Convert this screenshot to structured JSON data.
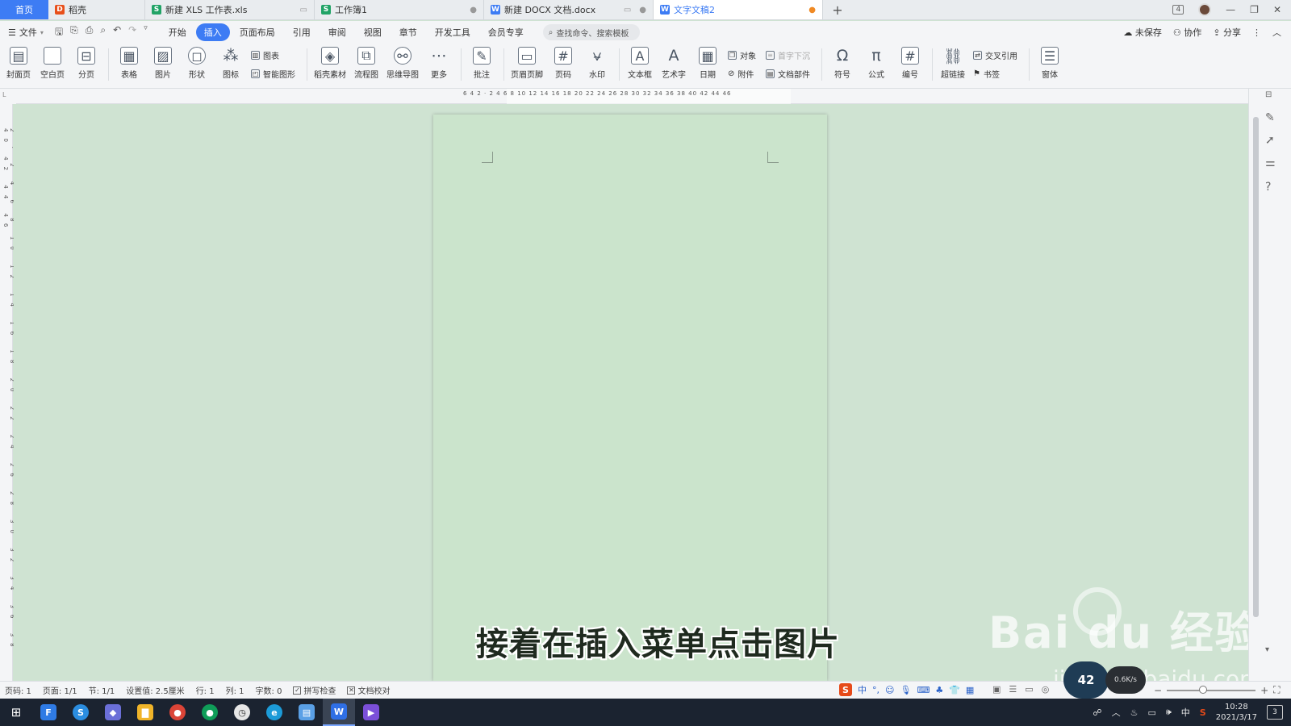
{
  "tabs": {
    "home": "首页",
    "items": [
      {
        "label": "稻壳",
        "icon": "docer-icon",
        "color": "#e8501b",
        "glyph": "D"
      },
      {
        "label": "新建 XLS 工作表.xls",
        "icon": "xls-icon",
        "color": "#21a366",
        "glyph": "S"
      },
      {
        "label": "工作簿1",
        "icon": "sheet-icon",
        "color": "#21a366",
        "glyph": "S"
      },
      {
        "label": "新建 DOCX 文档.docx",
        "icon": "docx-icon",
        "color": "#3d7cf4",
        "glyph": "W"
      },
      {
        "label": "文字文稿2",
        "icon": "docx-icon",
        "color": "#3d7cf4",
        "glyph": "W"
      }
    ],
    "add": "+",
    "window_badge": "4"
  },
  "menubar": {
    "file": "文件",
    "items": [
      "开始",
      "插入",
      "页面布局",
      "引用",
      "审阅",
      "视图",
      "章节",
      "开发工具",
      "会员专享"
    ],
    "active": "插入",
    "search_placeholder": "查找命令、搜索模板",
    "unsaved": "未保存",
    "collab": "协作",
    "share": "分享"
  },
  "ribbon": {
    "cover": "封面页",
    "blank_page": "空白页",
    "page_break": "分页",
    "table": "表格",
    "picture": "图片",
    "shape": "形状",
    "icons": "图标",
    "chart": "图表",
    "smart_art": "智能图形",
    "docer_material": "稻壳素材",
    "flowchart": "流程图",
    "mindmap": "思维导图",
    "more": "更多",
    "comment": "批注",
    "header_footer": "页眉页脚",
    "page_number": "页码",
    "watermark": "水印",
    "textbox": "文本框",
    "wordart": "艺术字",
    "date": "日期",
    "object": "对象",
    "attachment": "附件",
    "drop_cap": "首字下沉",
    "doc_parts": "文档部件",
    "symbol": "符号",
    "formula": "公式",
    "numbering": "编号",
    "hyperlink": "超链接",
    "cross_ref": "交叉引用",
    "bookmark": "书签",
    "window": "窗体"
  },
  "ruler": {
    "h_ticks": "6  4  2  ·  2  4  6  8  10  12  14  16  18  20  22  24  26  28  30  32  34  36  38  40  42  44  46",
    "v_ticks": "2 · 2 4 6 8 10 12 14 16 18 20 22 24 26 28 30 32 34 36 38 40 42 44 46"
  },
  "document": {
    "subtitle": "接着在插入菜单点击图片"
  },
  "watermark": {
    "brand": "Bai du 经验",
    "url": "jingyan.baidu.com"
  },
  "status": {
    "page_num": "页码: 1",
    "pages": "页面: 1/1",
    "section": "节: 1/1",
    "setting": "设置值: 2.5厘米",
    "row": "行: 1",
    "col": "列: 1",
    "words": "字数: 0",
    "spell": "拼写检查",
    "proof": "文档校对",
    "float_label": "42",
    "float_pill": "0.6K/s"
  },
  "ime": {
    "lang": "中",
    "punct": "°,"
  },
  "taskbar": {
    "apps": [
      {
        "name": "feather-app-icon",
        "color": "#2f7be5",
        "glyph": "F"
      },
      {
        "name": "sogou-browser-icon",
        "color": "#2b8de0",
        "glyph": "S"
      },
      {
        "name": "cube-app-icon",
        "color": "#6b6fd8",
        "glyph": "◆"
      },
      {
        "name": "file-explorer-icon",
        "color": "#f0b429",
        "glyph": "▇"
      },
      {
        "name": "chrome-icon",
        "color": "#db4437",
        "glyph": "●"
      },
      {
        "name": "chrome-profile-icon",
        "color": "#0f9d58",
        "glyph": "●"
      },
      {
        "name": "clock-app-icon",
        "color": "#e6e6e6",
        "glyph": "◷"
      },
      {
        "name": "edge-icon",
        "color": "#1c9bd8",
        "glyph": "e"
      },
      {
        "name": "notes-app-icon",
        "color": "#5aa0e6",
        "glyph": "▤"
      },
      {
        "name": "wps-writer-icon",
        "color": "#2f6fe5",
        "glyph": "W"
      },
      {
        "name": "video-app-icon",
        "color": "#7b4fd9",
        "glyph": "▶"
      }
    ],
    "ime_lang": "中",
    "time": "10:28",
    "date": "2021/3/17",
    "notif_count": "3"
  }
}
